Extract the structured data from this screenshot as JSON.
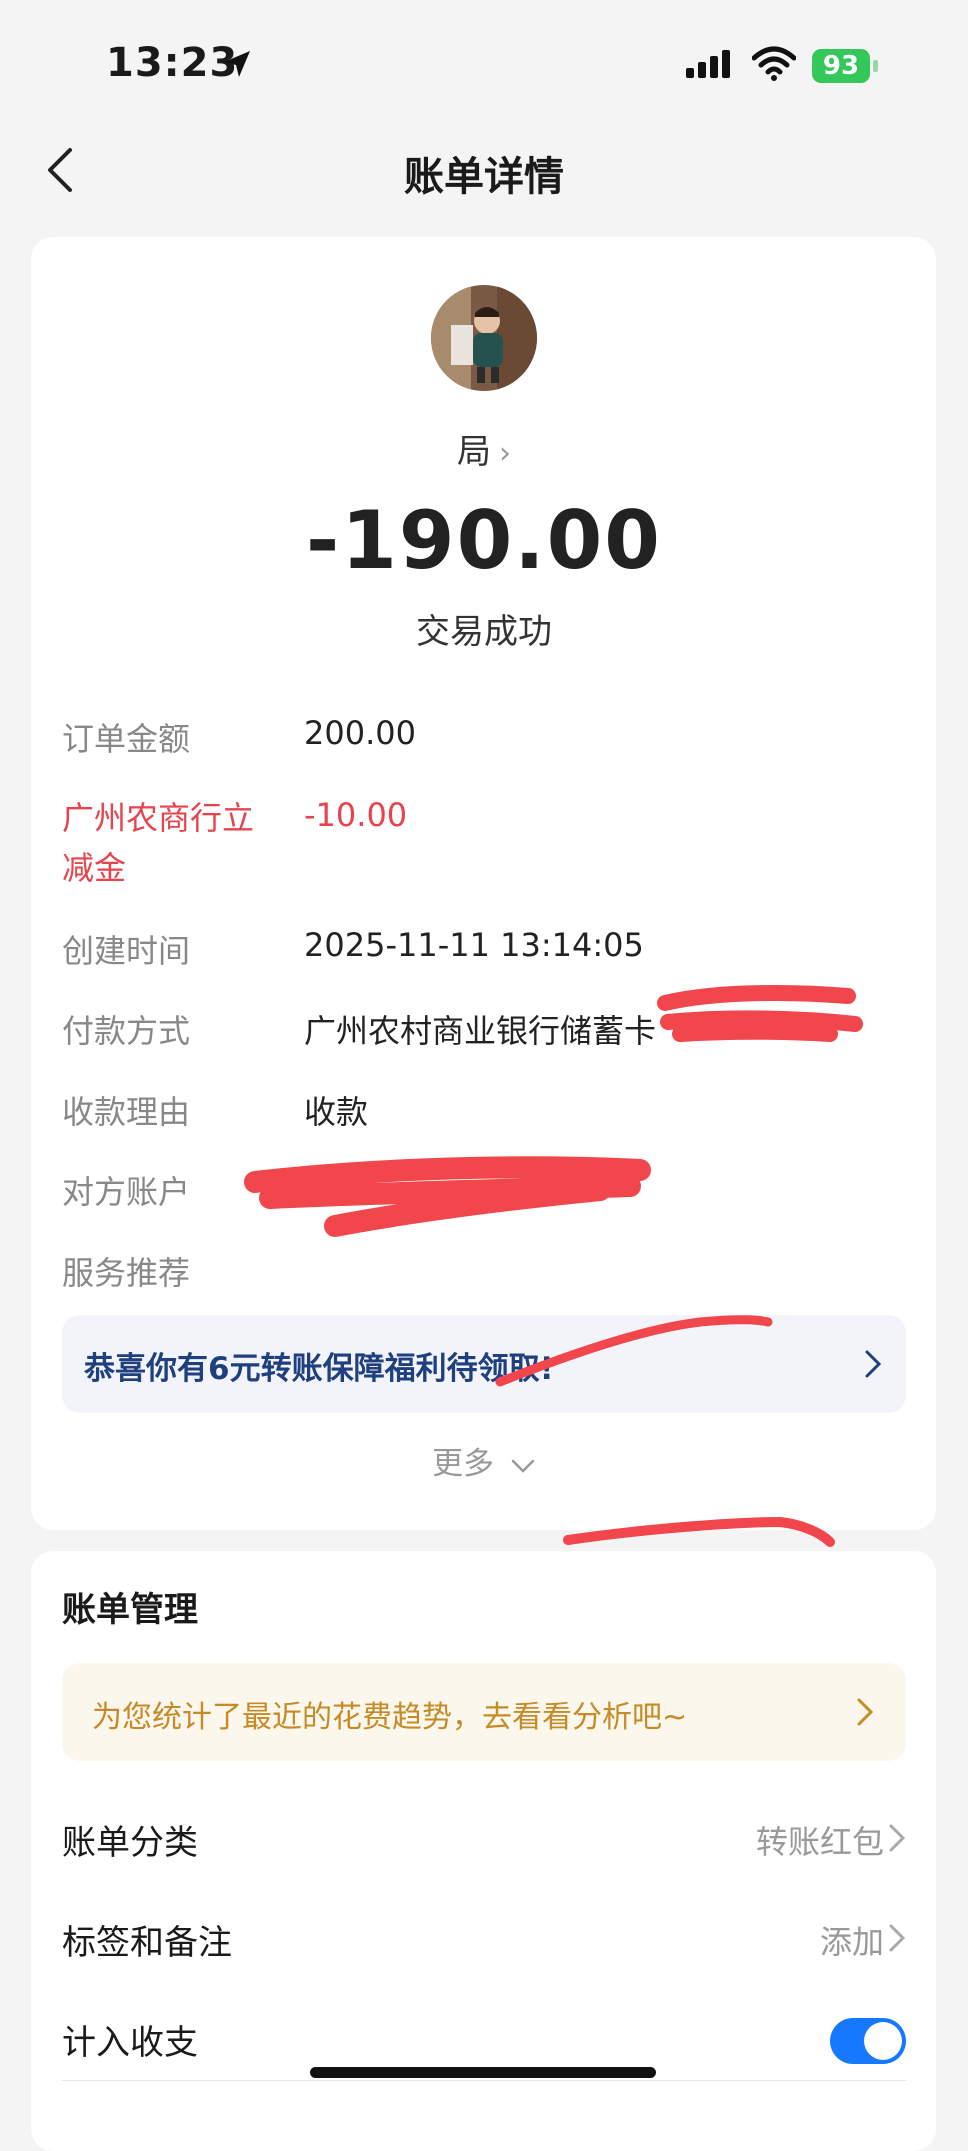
{
  "status_bar": {
    "time": "13:23",
    "battery": "93"
  },
  "nav": {
    "title": "账单详情"
  },
  "header": {
    "payee": "局",
    "amount": "-190.00",
    "status": "交易成功"
  },
  "details": {
    "order_amount": {
      "label": "订单金额",
      "value": "200.00"
    },
    "discount": {
      "label": "广州农商行立减金",
      "value": "-10.00"
    },
    "created_time": {
      "label": "创建时间",
      "value": "2025-11-11 13:14:05"
    },
    "payment_method": {
      "label": "付款方式",
      "value": "广州农村商业银行储蓄卡"
    },
    "reason": {
      "label": "收款理由",
      "value": "收款"
    },
    "counterparty": {
      "label": "对方账户",
      "value": ""
    },
    "service": {
      "label": "服务推荐"
    }
  },
  "promo": {
    "text": "恭喜你有6元转账保障福利待领取!"
  },
  "more": {
    "label": "更多"
  },
  "management": {
    "title": "账单管理",
    "trend_text": "为您统计了最近的花费趋势，去看看分析吧~",
    "category": {
      "label": "账单分类",
      "value": "转账红包"
    },
    "tags": {
      "label": "标签和备注",
      "value": "添加"
    },
    "include": {
      "label": "计入收支",
      "enabled": true
    }
  },
  "colors": {
    "accent_blue": "#1677ff",
    "discount_red": "#e8434d",
    "promo_text": "#1f3f7e",
    "trend_text": "#c68a26"
  }
}
